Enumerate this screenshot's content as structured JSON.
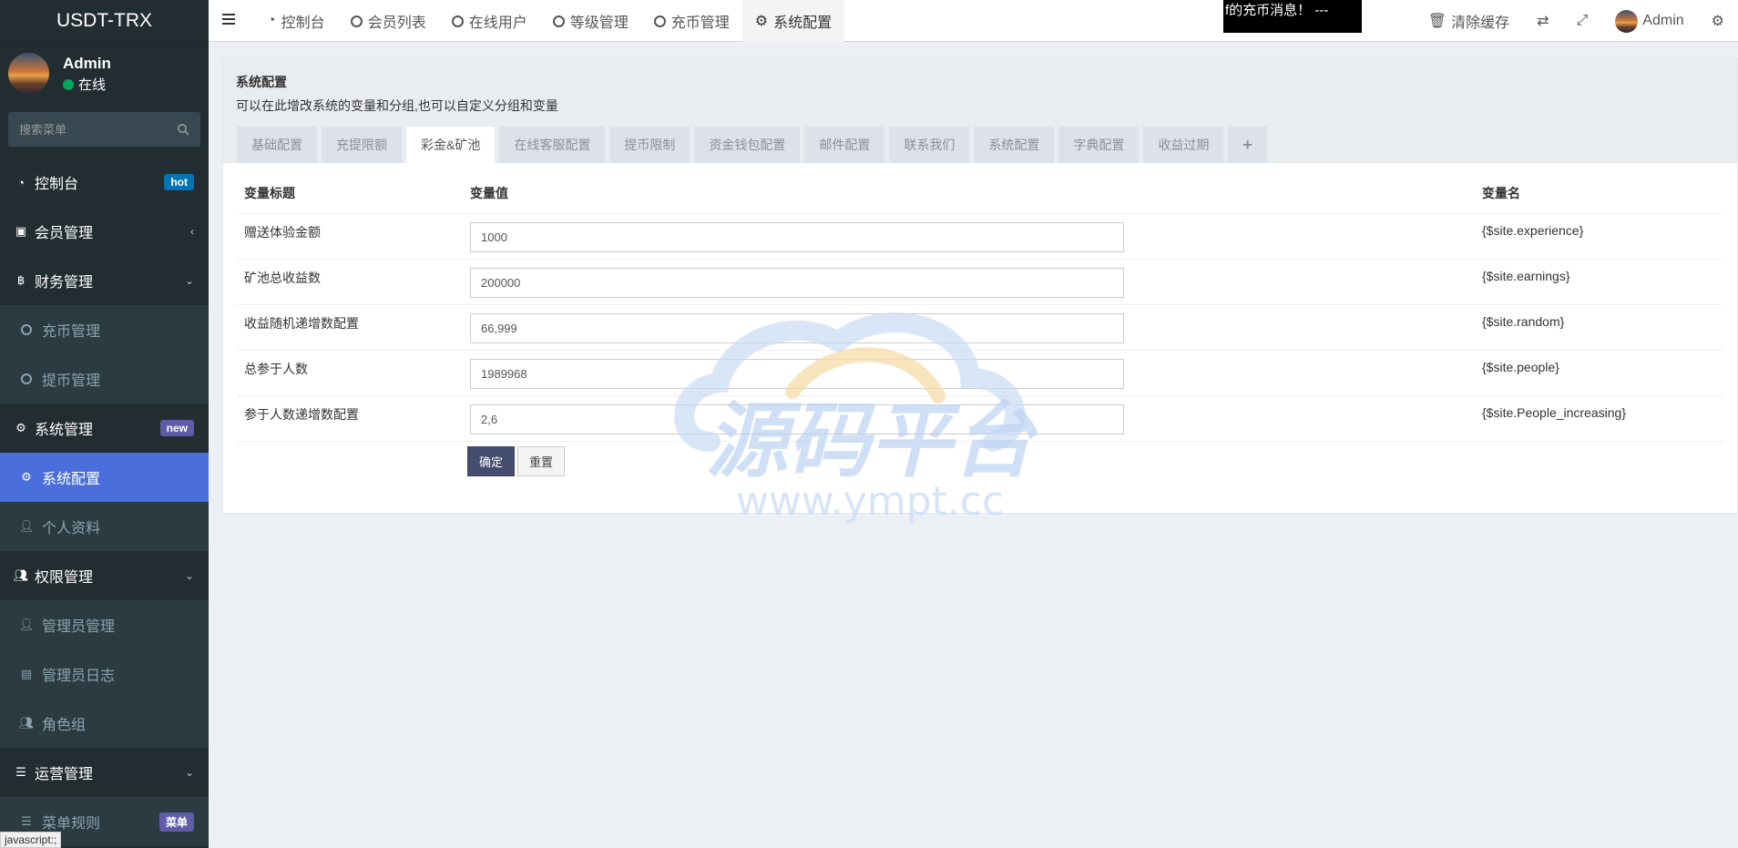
{
  "app": {
    "title": "USDT-TRX"
  },
  "user": {
    "name": "Admin",
    "status": "在线"
  },
  "search": {
    "placeholder": "搜索菜单"
  },
  "sidebar": {
    "items": [
      {
        "label": "控制台",
        "badge": "hot"
      },
      {
        "label": "会员管理"
      },
      {
        "label": "财务管理"
      },
      {
        "label": "充币管理"
      },
      {
        "label": "提币管理"
      },
      {
        "label": "系统管理",
        "badge": "new"
      },
      {
        "label": "系统配置"
      },
      {
        "label": "个人资料"
      },
      {
        "label": "权限管理"
      },
      {
        "label": "管理员管理"
      },
      {
        "label": "管理员日志"
      },
      {
        "label": "角色组"
      },
      {
        "label": "运营管理"
      },
      {
        "label": "菜单规则",
        "badge": "菜单"
      }
    ]
  },
  "status_bar": {
    "text": "javascript:;"
  },
  "topnav": {
    "tabs": [
      {
        "label": "控制台"
      },
      {
        "label": "会员列表"
      },
      {
        "label": "在线用户"
      },
      {
        "label": "等级管理"
      },
      {
        "label": "充币管理"
      },
      {
        "label": "系统配置"
      }
    ],
    "marquee": "f的充币消息！ ---",
    "clear_cache": "清除缓存",
    "user_name": "Admin"
  },
  "panel": {
    "title": "系统配置",
    "description": "可以在此增改系统的变量和分组,也可以自定义分组和变量",
    "tabs": [
      {
        "label": "基础配置"
      },
      {
        "label": "充提限额"
      },
      {
        "label": "彩金&矿池"
      },
      {
        "label": "在线客服配置"
      },
      {
        "label": "提币限制"
      },
      {
        "label": "资金钱包配置"
      },
      {
        "label": "邮件配置"
      },
      {
        "label": "联系我们"
      },
      {
        "label": "系统配置"
      },
      {
        "label": "字典配置"
      },
      {
        "label": "收益过期"
      },
      {
        "label": "+"
      }
    ],
    "active_tab": 2,
    "table": {
      "headers": [
        "变量标题",
        "变量值",
        "变量名"
      ],
      "rows": [
        {
          "title": "赠送体验金额",
          "value": "1000",
          "name": "{$site.experience}"
        },
        {
          "title": "矿池总收益数",
          "value": "200000",
          "name": "{$site.earnings}"
        },
        {
          "title": "收益随机递增数配置",
          "value": "66,999",
          "name": "{$site.random}"
        },
        {
          "title": "总参于人数",
          "value": "1989968",
          "name": "{$site.people}"
        },
        {
          "title": "参于人数递增数配置",
          "value": "2,6",
          "name": "{$site.People_increasing}"
        }
      ]
    },
    "buttons": {
      "submit": "确定",
      "reset": "重置"
    }
  },
  "watermark": {
    "text_cn": "源码平台",
    "text_url": "www.ympt.cc"
  }
}
